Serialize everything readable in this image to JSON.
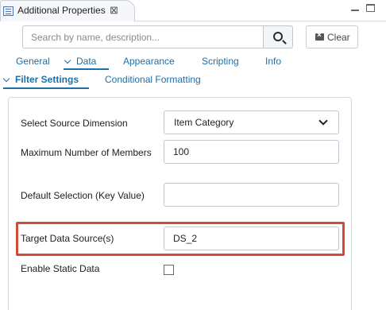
{
  "view": {
    "title": "Additional Properties",
    "close_glyph": "⊠"
  },
  "search": {
    "placeholder": "Search by name, description...",
    "value": ""
  },
  "clear": {
    "label": "Clear"
  },
  "tabs": [
    {
      "label": "General"
    },
    {
      "label": "Data"
    },
    {
      "label": "Appearance"
    },
    {
      "label": "Scripting"
    },
    {
      "label": "Info"
    }
  ],
  "active_tab": "Data",
  "subtabs": [
    {
      "label": "Filter Settings"
    },
    {
      "label": "Conditional Formatting"
    }
  ],
  "active_subtab": "Filter Settings",
  "form": {
    "source_dimension": {
      "label": "Select Source Dimension",
      "value": "Item Category"
    },
    "max_members": {
      "label": "Maximum Number of Members",
      "value": "100"
    },
    "default_selection": {
      "label": "Default Selection (Key Value)",
      "value": ""
    },
    "target_data_source": {
      "label": "Target Data Source(s)",
      "value": "DS_2"
    },
    "enable_static_data": {
      "label": "Enable Static Data",
      "checked": false
    }
  },
  "colors": {
    "accent": "#1d6fa5",
    "highlight": "#d04a3c"
  },
  "icons": [
    "properties-view-icon",
    "close-icon",
    "minimize-icon",
    "maximize-icon",
    "search-icon",
    "clear-icon",
    "chevron-down-icon"
  ]
}
